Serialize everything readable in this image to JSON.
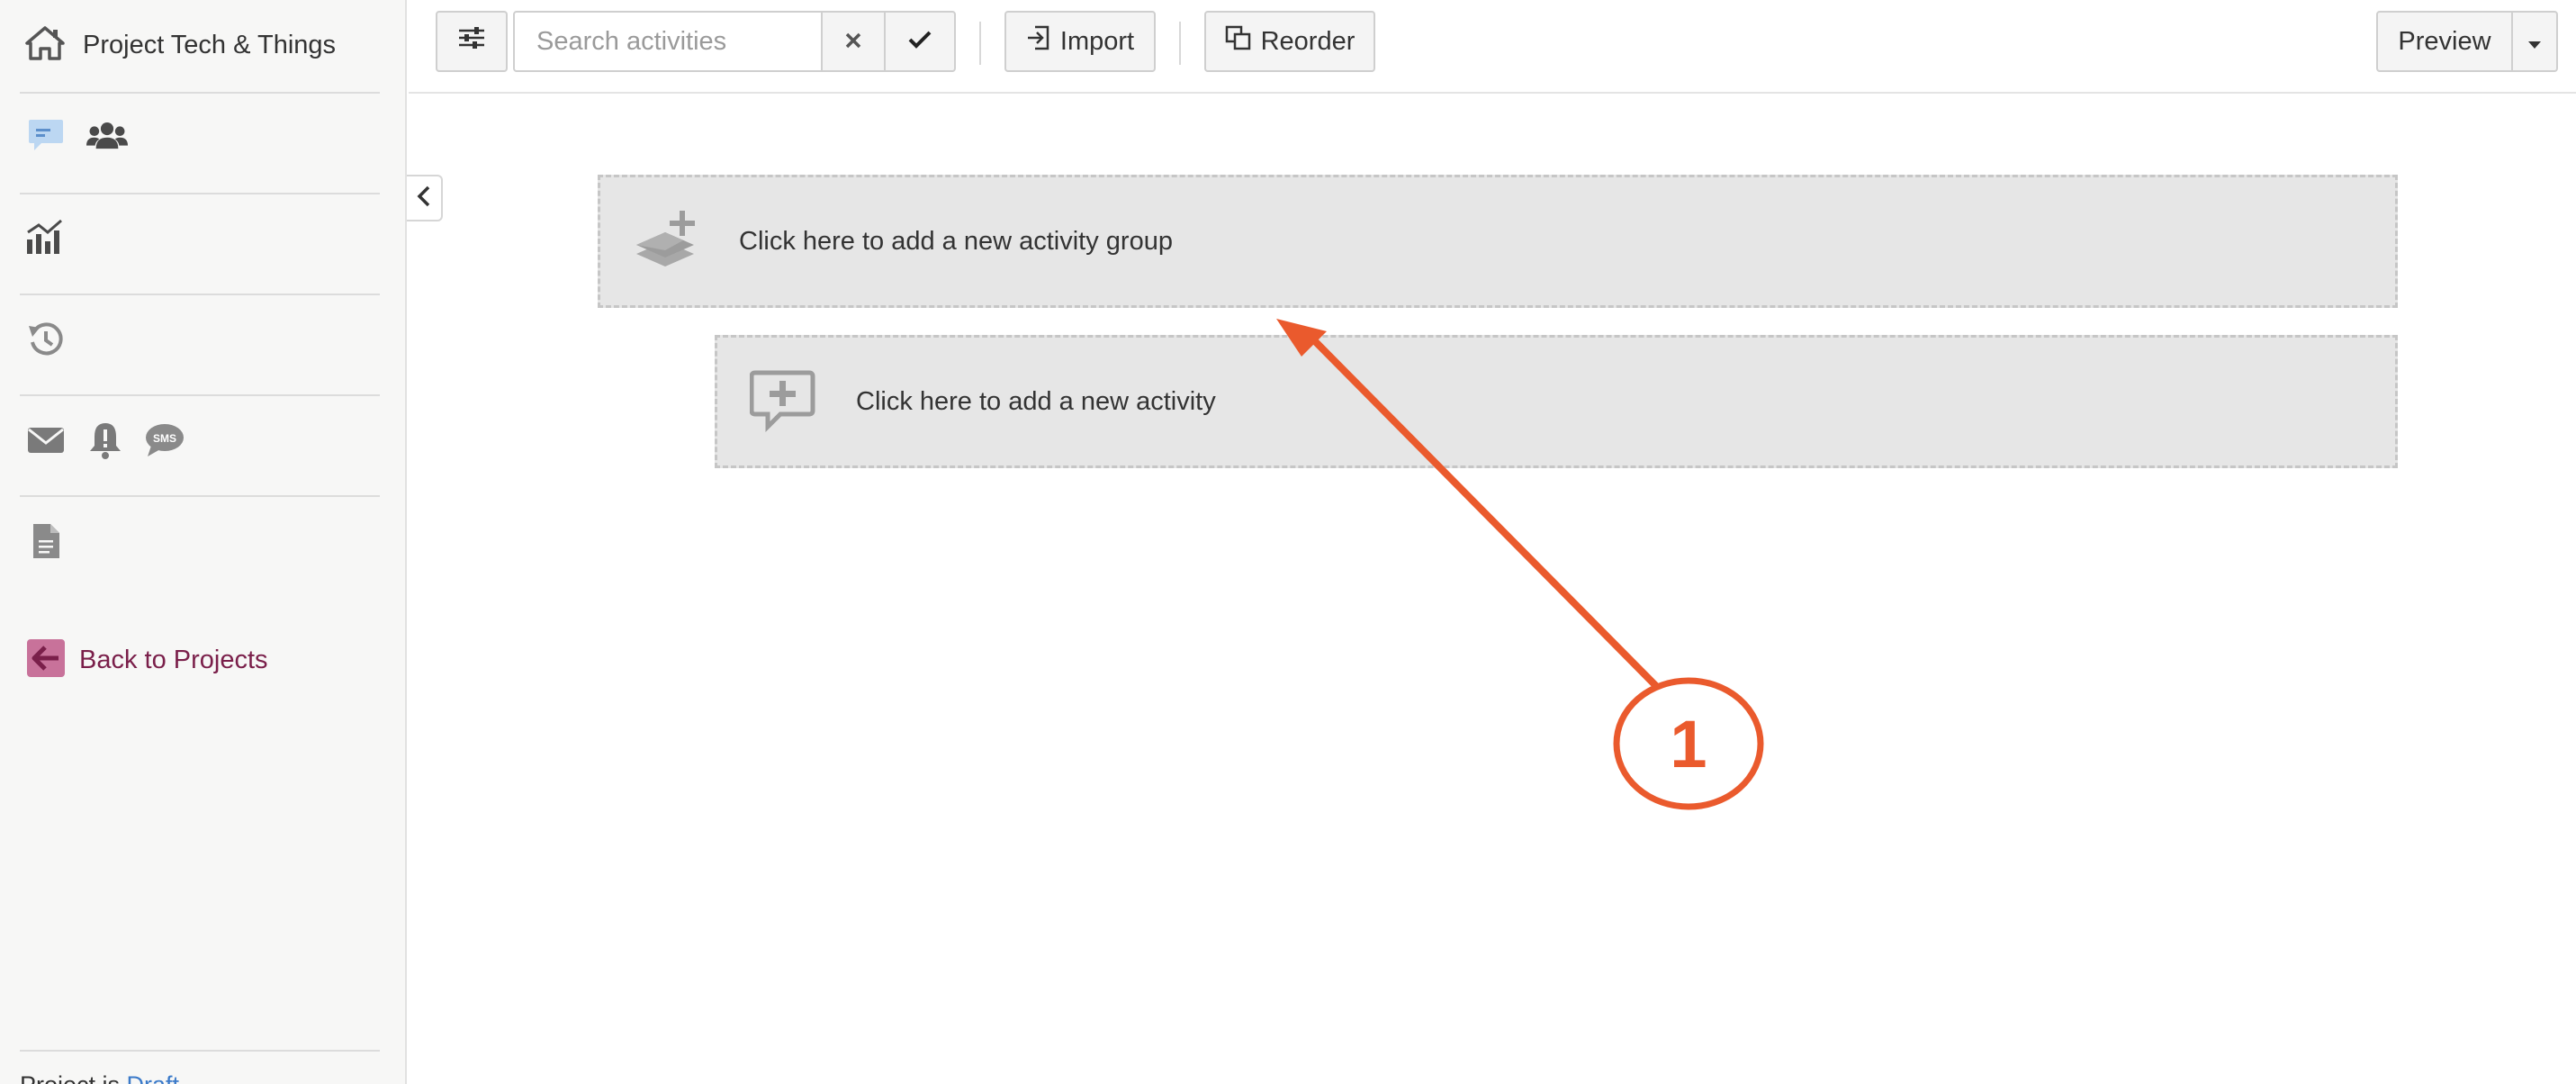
{
  "sidebar": {
    "project_title": "Project Tech & Things",
    "back_label": "Back to Projects",
    "footer_prefix": "Project is ",
    "footer_status": "Draft",
    "icons": {
      "home": "home-icon",
      "chat": "chat-icon",
      "users": "users-icon",
      "analytics": "chart-icon",
      "history": "history-icon",
      "email": "email-icon",
      "alert": "alert-icon",
      "sms": "sms-icon",
      "document": "document-icon",
      "back": "arrow-left-icon"
    },
    "sms_text": "SMS"
  },
  "toolbar": {
    "search_placeholder": "Search activities",
    "import_label": "Import",
    "reorder_label": "Reorder",
    "preview_label": "Preview"
  },
  "main": {
    "add_group_label": "Click here to add a new activity group",
    "add_activity_label": "Click here to add a new activity"
  },
  "annotation": {
    "number": "1",
    "color": "#ea5a2d"
  },
  "colors": {
    "accent_maroon": "#7a1f4a",
    "link_blue": "#3b7ac9",
    "sidebar_bg": "#f7f7f6"
  }
}
